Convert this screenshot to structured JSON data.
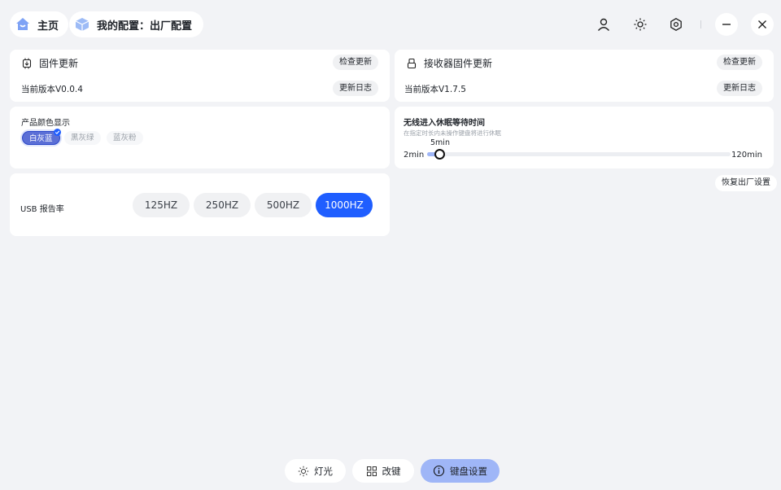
{
  "header": {
    "home_label": "主页",
    "profile_label": "我的配置：出厂配置",
    "icons": [
      "home-icon",
      "cube-icon",
      "user-icon",
      "brightness-icon",
      "settings-icon",
      "minimize-icon",
      "close-icon"
    ]
  },
  "firmware": {
    "title": "固件更新",
    "check_label": "检查更新",
    "version_text": "当前版本V0.0.4",
    "log_label": "更新日志"
  },
  "receiver": {
    "title": "接收器固件更新",
    "check_label": "检查更新",
    "version_text": "当前版本V1.7.5",
    "log_label": "更新日志"
  },
  "product_color": {
    "title": "产品颜色显示",
    "options": [
      "白灰蓝",
      "黑灰绿",
      "蓝灰粉"
    ],
    "selected": "白灰蓝"
  },
  "sleep": {
    "title": "无线进入休眠等待时间",
    "description": "在指定时长内未操作键盘将进行休眠",
    "min_label": "2min",
    "max_label": "120min",
    "current_label": "5min",
    "slider_value_fraction": 0.025
  },
  "restore_label": "恢复出厂设置",
  "usb": {
    "label": "USB 报告率",
    "options": [
      "125HZ",
      "250HZ",
      "500HZ",
      "1000HZ"
    ],
    "selected": "1000HZ"
  },
  "bottom_nav": {
    "lighting_label": "灯光",
    "keymap_label": "改键",
    "keyboard_settings_label": "键盘设置"
  },
  "colors": {
    "accent": "#1f5eff",
    "background": "#f2f3f6",
    "active_tab": "#9fb6f7"
  }
}
